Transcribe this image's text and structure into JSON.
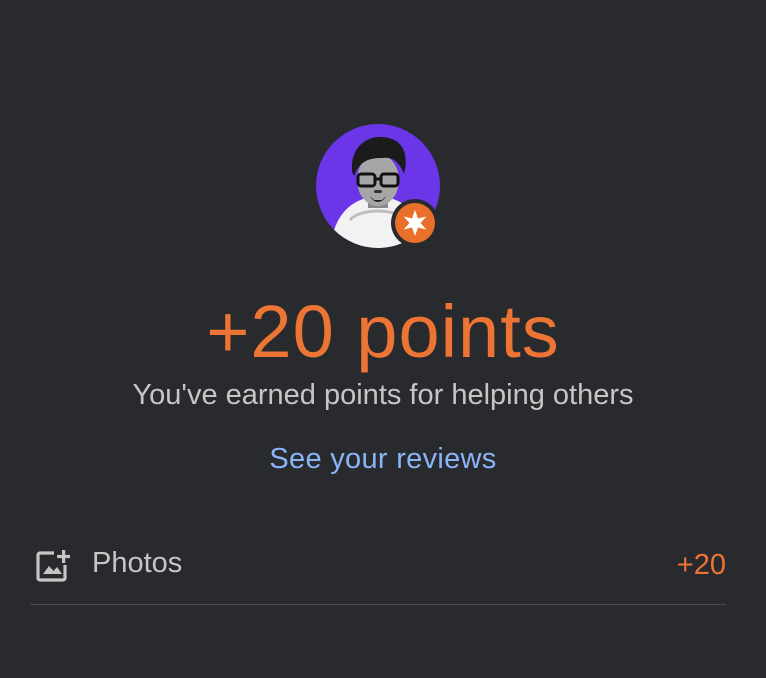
{
  "reward": {
    "points_text": "+20 points",
    "subtitle": "You've earned points for helping others",
    "link_label": "See your reviews"
  },
  "colors": {
    "background": "#292a2d",
    "accent": "#ec7434",
    "link": "#8ab4f8",
    "text": "#c4c7c5",
    "avatar_bg": "#6a36e8"
  },
  "breakdown": [
    {
      "icon": "add-photo-icon",
      "label": "Photos",
      "value": "+20"
    }
  ]
}
